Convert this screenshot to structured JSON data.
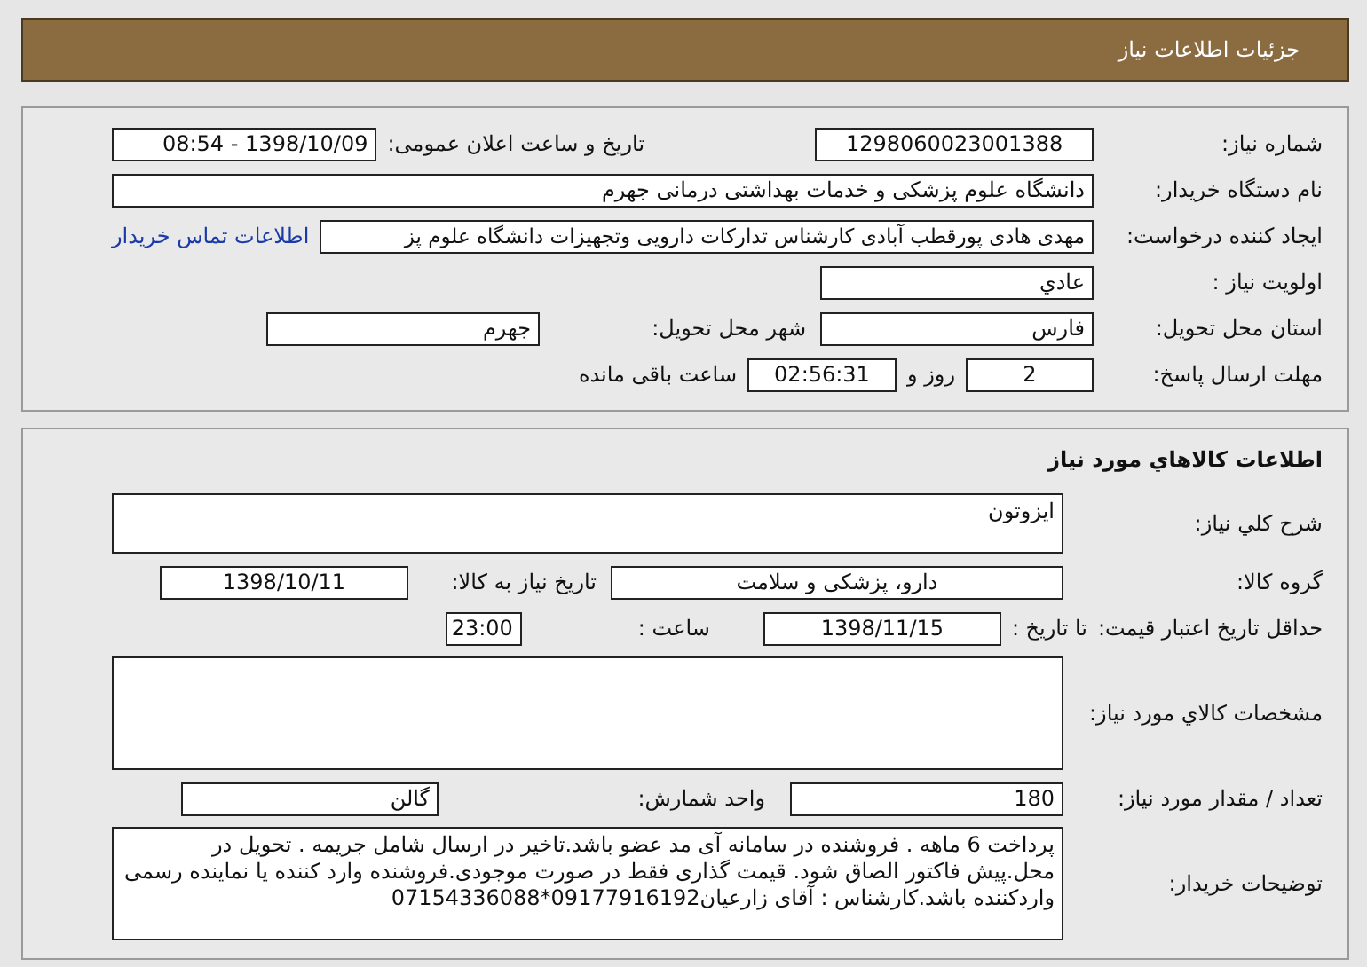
{
  "header": {
    "title": "جزئیات اطلاعات نیاز"
  },
  "general": {
    "need_number_label": "شماره نیاز:",
    "need_number": "1298060023001388",
    "announce_label": "تاریخ و ساعت اعلان عمومی:",
    "announce": "1398/10/09 - 08:54",
    "buyer_label": "نام دستگاه خریدار:",
    "buyer": "دانشگاه علوم پزشکی و خدمات بهداشتی درمانی جهرم",
    "creator_label": "ایجاد کننده درخواست:",
    "creator": "مهدی هادی پورقطب آبادی کارشناس تداركات دارویی وتجهیزات دانشگاه علوم پز",
    "contact_link": "اطلاعات تماس خریدار",
    "priority_label": "اولویت نیاز :",
    "priority": "عادي",
    "province_label": "استان محل تحویل:",
    "province": "فارس",
    "city_label": "شهر محل تحویل:",
    "city": "جهرم",
    "deadline_label": "مهلت ارسال پاسخ:",
    "days": "2",
    "days_label": "روز و",
    "time": "02:56:31",
    "remaining_label": "ساعت باقی مانده"
  },
  "goods": {
    "title": "اطلاعات کالاهاي مورد نياز",
    "summary_label": "شرح کلي نياز:",
    "summary": "ایزوتون",
    "group_label": "گروه کالا:",
    "group": "دارو، پزشکی و سلامت",
    "need_date_label": "تاریخ نیاز به کالا:",
    "need_date": "1398/10/11",
    "validity_label": "حداقل تاریخ اعتبار قیمت:",
    "until_label": "تا تاریخ :",
    "until": "1398/11/15",
    "hour_label": "ساعت :",
    "hour": "23:00",
    "specs_label": "مشخصات کالاي مورد نياز:",
    "qty_label": "تعداد / مقدار مورد نیاز:",
    "qty": "180",
    "unit_label": "واحد شمارش:",
    "unit": "گالن",
    "notes_label": "توضیحات خریدار:",
    "notes": "پرداخت 6 ماهه . فروشنده در سامانه آی مد عضو باشد.تاخیر در ارسال شامل جریمه  . تحویل در محل.پیش فاکتور الصاق شود. قیمت گذاری فقط در صورت موجودی.فروشنده وارد کننده یا نماینده رسمی واردکننده باشد.کارشناس : آقای زارعیان09177916192*07154336088"
  }
}
